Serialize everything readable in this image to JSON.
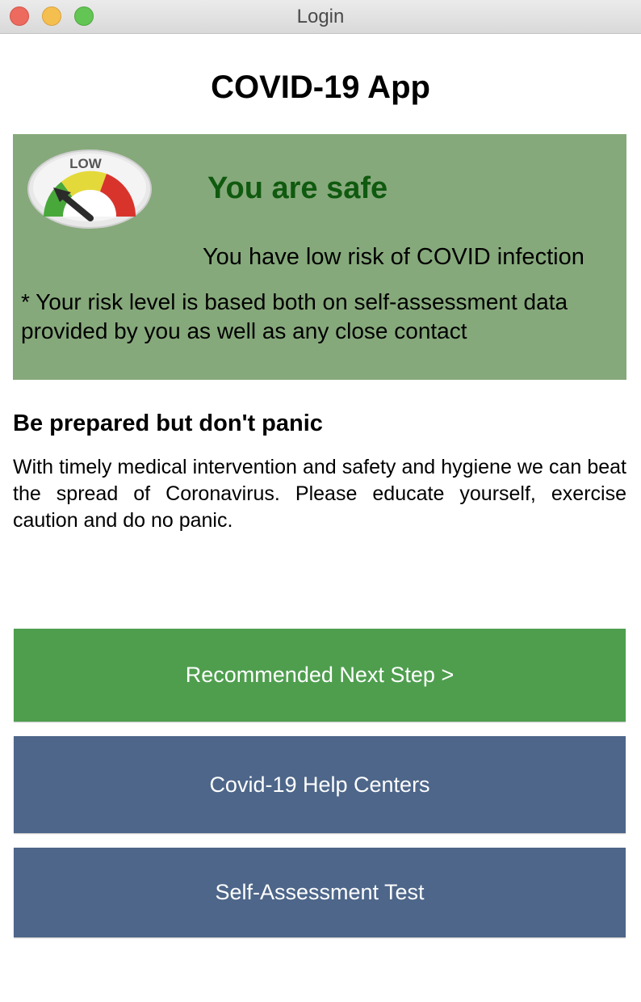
{
  "window": {
    "title": "Login"
  },
  "app": {
    "title": "COVID-19 App"
  },
  "status": {
    "gauge_label": "LOW",
    "gauge_icon": "risk-gauge-low",
    "heading": "You are safe",
    "risk_text": "You have low risk of COVID infection",
    "note": "* Your risk level is based both on self-assessment data provided by you as well as any close contact",
    "panel_color": "#86a97b",
    "heading_color": "#0f5a0f"
  },
  "info": {
    "heading": "Be prepared but don't panic",
    "body": "With timely medical intervention and safety and hygiene we can beat the spread of Coronavirus. Please educate yourself, exercise caution and do no panic."
  },
  "buttons": {
    "next_step": "Recommended Next Step >",
    "help_centers": "Covid-19 Help Centers",
    "self_assessment": "Self-Assessment Test"
  },
  "colors": {
    "next_step_button": "#4e9e4e",
    "secondary_button": "#4d6689"
  }
}
